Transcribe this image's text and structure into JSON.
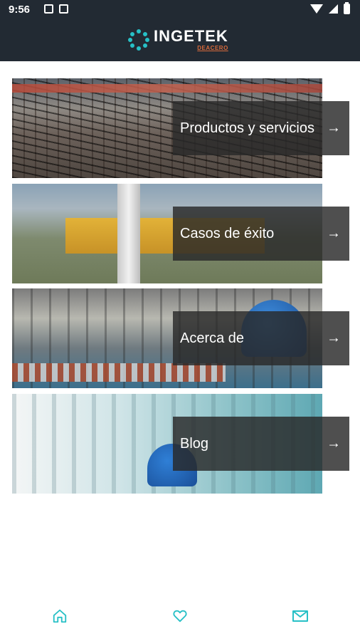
{
  "status_bar": {
    "time": "9:56"
  },
  "header": {
    "brand_name": "INGETEK",
    "brand_sub": "DEACERO",
    "accent_color": "#27c0c6"
  },
  "cards": [
    {
      "label": "Productos y servicios",
      "arrow": "→",
      "icon": "arrow-right-icon"
    },
    {
      "label": "Casos de éxito",
      "arrow": "→",
      "icon": "arrow-right-icon"
    },
    {
      "label": "Acerca de",
      "arrow": "→",
      "icon": "arrow-right-icon"
    },
    {
      "label": "Blog",
      "arrow": "→",
      "icon": "arrow-right-icon"
    }
  ],
  "bottom_nav": {
    "items": [
      {
        "icon": "home-icon"
      },
      {
        "icon": "heart-icon"
      },
      {
        "icon": "mail-icon"
      }
    ],
    "color": "#27c0c6"
  }
}
